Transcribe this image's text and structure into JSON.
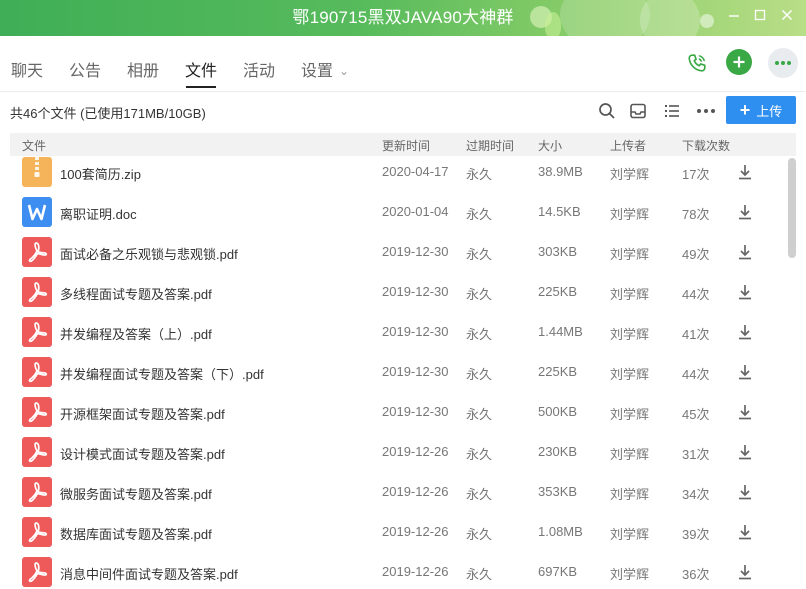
{
  "window": {
    "title": "鄂190715黑双JAVA90大神群",
    "controls": [
      "minimize",
      "maximize",
      "close"
    ]
  },
  "tabs": [
    {
      "label": "聊天",
      "active": false
    },
    {
      "label": "公告",
      "active": false
    },
    {
      "label": "相册",
      "active": false
    },
    {
      "label": "文件",
      "active": true
    },
    {
      "label": "活动",
      "active": false
    },
    {
      "label": "设置",
      "active": false,
      "has_dropdown": true
    }
  ],
  "header_actions": [
    "phone-icon",
    "add-icon",
    "more-icon"
  ],
  "toolbar": {
    "summary": "共46个文件 (已使用171MB/10GB)",
    "icons": [
      "search-icon",
      "inbox-icon",
      "list-view-icon",
      "more-icon"
    ],
    "upload_label": "上传"
  },
  "table": {
    "columns": {
      "name": "文件",
      "updated": "更新时间",
      "expires": "过期时间",
      "size": "大小",
      "uploader": "上传者",
      "downloads": "下载次数"
    },
    "rows": [
      {
        "type": "zip",
        "name": "100套简历.zip",
        "updated": "2020-04-17",
        "expires": "永久",
        "size": "38.9MB",
        "uploader": "刘学辉",
        "downloads": "17次"
      },
      {
        "type": "doc",
        "name": "离职证明.doc",
        "updated": "2020-01-04",
        "expires": "永久",
        "size": "14.5KB",
        "uploader": "刘学辉",
        "downloads": "78次"
      },
      {
        "type": "pdf",
        "name": "面试必备之乐观锁与悲观锁.pdf",
        "updated": "2019-12-30",
        "expires": "永久",
        "size": "303KB",
        "uploader": "刘学辉",
        "downloads": "49次"
      },
      {
        "type": "pdf",
        "name": "多线程面试专题及答案.pdf",
        "updated": "2019-12-30",
        "expires": "永久",
        "size": "225KB",
        "uploader": "刘学辉",
        "downloads": "44次"
      },
      {
        "type": "pdf",
        "name": "并发编程及答案（上）.pdf",
        "updated": "2019-12-30",
        "expires": "永久",
        "size": "1.44MB",
        "uploader": "刘学辉",
        "downloads": "41次"
      },
      {
        "type": "pdf",
        "name": "并发编程面试专题及答案（下）.pdf",
        "updated": "2019-12-30",
        "expires": "永久",
        "size": "225KB",
        "uploader": "刘学辉",
        "downloads": "44次"
      },
      {
        "type": "pdf",
        "name": "开源框架面试专题及答案.pdf",
        "updated": "2019-12-30",
        "expires": "永久",
        "size": "500KB",
        "uploader": "刘学辉",
        "downloads": "45次"
      },
      {
        "type": "pdf",
        "name": "设计模式面试专题及答案.pdf",
        "updated": "2019-12-26",
        "expires": "永久",
        "size": "230KB",
        "uploader": "刘学辉",
        "downloads": "31次"
      },
      {
        "type": "pdf",
        "name": "微服务面试专题及答案.pdf",
        "updated": "2019-12-26",
        "expires": "永久",
        "size": "353KB",
        "uploader": "刘学辉",
        "downloads": "34次"
      },
      {
        "type": "pdf",
        "name": "数据库面试专题及答案.pdf",
        "updated": "2019-12-26",
        "expires": "永久",
        "size": "1.08MB",
        "uploader": "刘学辉",
        "downloads": "39次"
      },
      {
        "type": "pdf",
        "name": "消息中间件面试专题及答案.pdf",
        "updated": "2019-12-26",
        "expires": "永久",
        "size": "697KB",
        "uploader": "刘学辉",
        "downloads": "36次"
      }
    ]
  },
  "colors": {
    "titlebar": "#4db35a",
    "accent": "#2f8ff0",
    "zip": "#f5b35a",
    "doc": "#3d8ef0",
    "pdf": "#ee5a5a",
    "green_action": "#3aa845"
  }
}
